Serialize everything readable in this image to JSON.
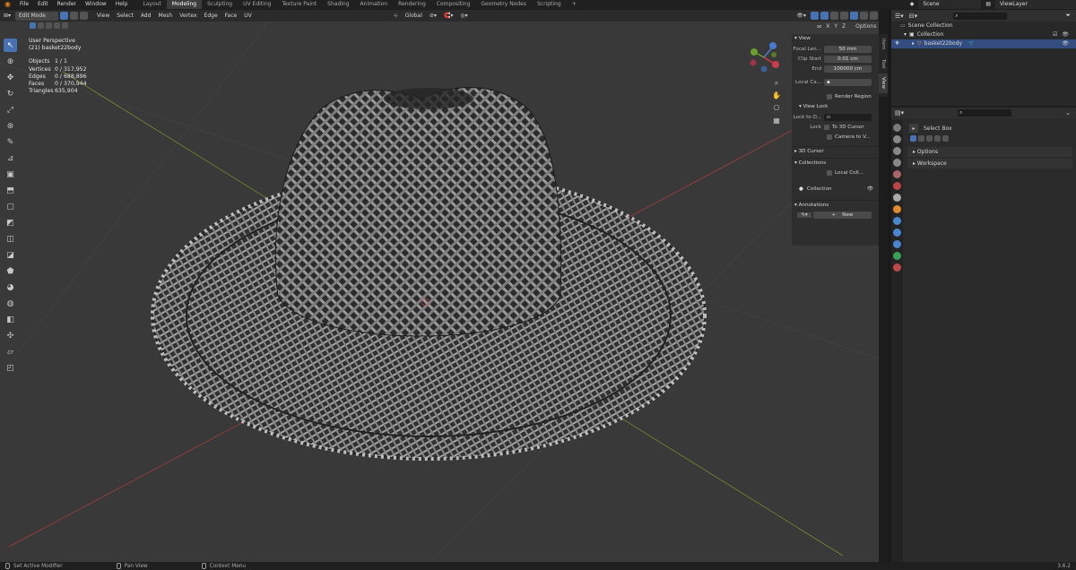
{
  "menus": [
    "File",
    "Edit",
    "Render",
    "Window",
    "Help"
  ],
  "workspaces": [
    "Layout",
    "Modeling",
    "Sculpting",
    "UV Editing",
    "Texture Paint",
    "Shading",
    "Animation",
    "Rendering",
    "Compositing",
    "Geometry Nodes",
    "Scripting"
  ],
  "active_workspace": "Modeling",
  "scene_label": "Scene",
  "viewlayer_label": "ViewLayer",
  "header": {
    "mode": "Edit Mode",
    "items": [
      "View",
      "Select",
      "Add",
      "Mesh",
      "Vertex",
      "Edge",
      "Face",
      "UV"
    ],
    "transform": "Global",
    "options": "Options",
    "xyz": [
      "X",
      "Y",
      "Z"
    ]
  },
  "overlay": {
    "perspective": "User Perspective",
    "object_name": "(21) basket22body",
    "stats": [
      {
        "k": "Objects",
        "v": "1 / 1"
      },
      {
        "k": "Vertices",
        "v": "0 / 317,952"
      },
      {
        "k": "Edges",
        "v": "0 / 688,896"
      },
      {
        "k": "Faces",
        "v": "0 / 370,944"
      },
      {
        "k": "Triangles",
        "v": "635,904"
      }
    ]
  },
  "npanel": {
    "view_head": "View",
    "focal_label": "Focal Len...",
    "focal_value": "50 mm",
    "clip_start_label": "Clip Start",
    "clip_start_value": "0.01 cm",
    "end_label": "End",
    "end_value": "100000 cm",
    "local_camera_label": "Local Ca...",
    "render_region": "Render Region",
    "view_lock_head": "View Lock",
    "lock_to_label": "Lock to O...",
    "lock_label": "Lock",
    "to_3d_cursor": "To 3D Cursor",
    "camera_to_view": "Camera to V...",
    "cursor_head": "3D Cursor",
    "collections_head": "Collections",
    "local_coll": "Local Coll...",
    "collection": "Collection",
    "annotations_head": "Annotations",
    "new_label": "New"
  },
  "side_tabs": [
    "Item",
    "Tool",
    "View"
  ],
  "outliner": {
    "rows": [
      "Scene Collection",
      "Collection",
      "basket22body"
    ]
  },
  "properties": {
    "tool_name": "Select Box",
    "panels": [
      "Options",
      "Workspace"
    ]
  },
  "status": [
    "Set Active Modifier",
    "Pan View",
    "Context Menu"
  ],
  "version": "3.6.2",
  "colors": {
    "accent": "#4772b3",
    "viewport": "#393939",
    "x_axis": "#a33d3d",
    "y_axis": "#6f8c2e"
  }
}
